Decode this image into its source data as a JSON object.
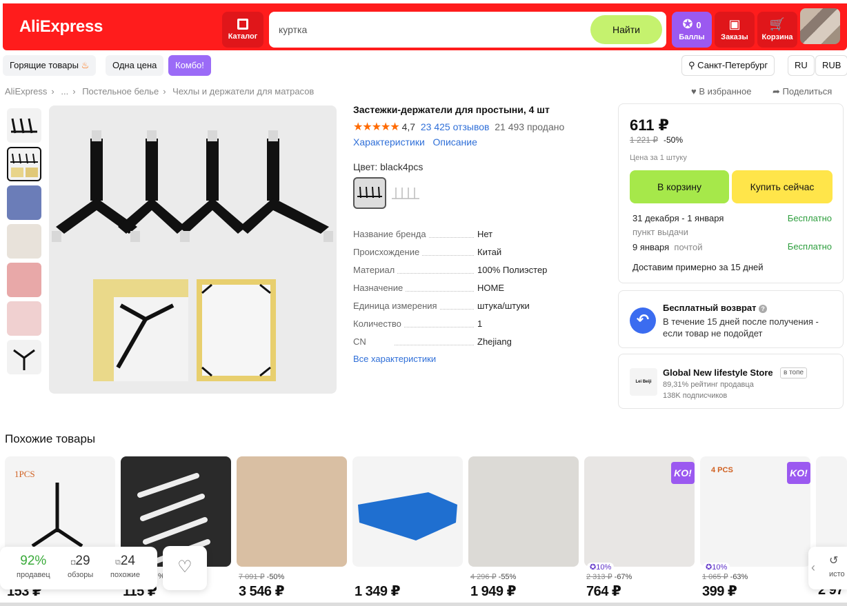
{
  "header": {
    "logo": "AliExpress",
    "catalog_label": "Каталог",
    "search_value": "куртка",
    "search_button": "Найти",
    "points_count": "0",
    "points_label": "Баллы",
    "orders_label": "Заказы",
    "cart_label": "Корзина"
  },
  "subnav": {
    "hot": "Горящие товары",
    "one_price": "Одна цена",
    "combo": "Комбо!",
    "city": "Санкт-Петербург",
    "lang": "RU",
    "currency": "RUB"
  },
  "breadcrumbs": [
    "AliExpress",
    "...",
    "Постельное белье",
    "Чехлы и держатели для матрасов"
  ],
  "actions": {
    "favorite": "В избранное",
    "share": "Поделиться"
  },
  "product": {
    "title": "Застежки-держатели для простыни, 4 шт",
    "stars": "★★★★★",
    "rating": "4,7",
    "reviews": "23 425 отзывов",
    "sold": "21 493 продано",
    "tab_specs": "Характеристики",
    "tab_desc": "Описание",
    "color_label": "Цвет: black4pcs",
    "specs": [
      {
        "k": "Название бренда",
        "v": "Нет"
      },
      {
        "k": "Происхождение",
        "v": "Китай"
      },
      {
        "k": "Материал",
        "v": "100% Полиэстер"
      },
      {
        "k": "Назначение",
        "v": "HOME"
      },
      {
        "k": "Единица измерения",
        "v": "штука/штуки"
      },
      {
        "k": "Количество",
        "v": "1"
      },
      {
        "k": "CN",
        "v": "Zhejiang"
      }
    ],
    "all_specs": "Все характеристики"
  },
  "buy": {
    "price": "611 ₽",
    "old_price": "1 221 ₽",
    "discount": "-50%",
    "unit": "Цена за 1 штуку",
    "to_cart": "В корзину",
    "buy_now": "Купить сейчас",
    "delivery1_date": "31 декабря - 1 января",
    "delivery1_type": "пункт выдачи",
    "delivery1_cost": "Бесплатно",
    "delivery2_date": "9 января",
    "delivery2_type": "почтой",
    "delivery2_cost": "Бесплатно",
    "eta": "Доставим примерно за 15 дней"
  },
  "return": {
    "title": "Бесплатный возврат",
    "text": "В течение 15 дней после получения - если товар не подойдет"
  },
  "store": {
    "name": "Global New lifestyle Store",
    "badge": "в топе",
    "rating": "89,31% рейтинг продавца",
    "subs": "138K подписчиков",
    "logo_text": "Lei Beiji"
  },
  "similar": {
    "title": "Похожие товары",
    "cards": [
      {
        "price": "153 ₽",
        "old": "",
        "disc": "",
        "label": "1PCS"
      },
      {
        "price": "115 ₽",
        "old": "",
        "disc": "%",
        "label": ""
      },
      {
        "price": "3 546 ₽",
        "old": "7 091 ₽",
        "disc": "-50%",
        "label": ""
      },
      {
        "price": "1 349 ₽",
        "old": "",
        "disc": "",
        "label": ""
      },
      {
        "price": "1 949 ₽",
        "old": "4 296 ₽",
        "disc": "-55%",
        "label": ""
      },
      {
        "price": "764 ₽",
        "old": "2 313 ₽",
        "disc": "-67%",
        "label": ""
      },
      {
        "price": "399 ₽",
        "old": "1 065 ₽",
        "disc": "-63%",
        "label": "4 PCS"
      },
      {
        "price": "2 97",
        "old": "",
        "disc": "",
        "label": ""
      }
    ],
    "badge10": "10%",
    "ko": "KO!"
  },
  "stats": {
    "sellers_pct": "92%",
    "sellers_label": "продавец",
    "reviews_n": "29",
    "reviews_label": "обзоры",
    "similar_n": "24",
    "similar_label": "похожие",
    "history_label": "исто"
  }
}
